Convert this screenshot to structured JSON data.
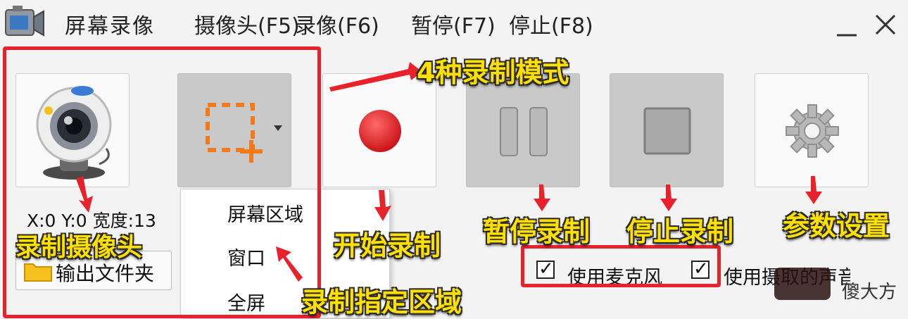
{
  "window": {
    "title": "屏幕录像",
    "menu": [
      "摄像头(F5)",
      "录像(F6)",
      "暂停(F7)",
      "停止(F8)"
    ],
    "minimize_glyph": "—",
    "close_glyph": "✕"
  },
  "toolbar": {
    "coords_text": "X:0 Y:0 宽度:13",
    "folder_label": "输出文件夹"
  },
  "dropdown": {
    "items": [
      "屏幕区域",
      "窗口",
      "全屏"
    ]
  },
  "options": {
    "mic_label": "使用麦克风",
    "sys_label": "使用摄取的声音",
    "mic_checked": true,
    "sys_checked": true,
    "check_glyph": "✓"
  },
  "annotations": {
    "modes": "4种录制模式",
    "record_camera": "录制摄像头",
    "start_record": "开始录制",
    "pause_record": "暂停录制",
    "stop_record": "停止录制",
    "settings": "参数设置",
    "record_region": "录制指定区域"
  },
  "watermark": {
    "text": "傻大方"
  },
  "colors": {
    "annotation_red": "#e8222a",
    "annotation_yellow": "#ffe000",
    "record_red": "#e3161c",
    "region_orange": "#f27a1a"
  },
  "icons": [
    "camera-app-icon",
    "webcam-icon",
    "region-select-icon",
    "record-dot-icon",
    "pause-icon",
    "stop-icon",
    "gear-icon",
    "folder-icon"
  ]
}
